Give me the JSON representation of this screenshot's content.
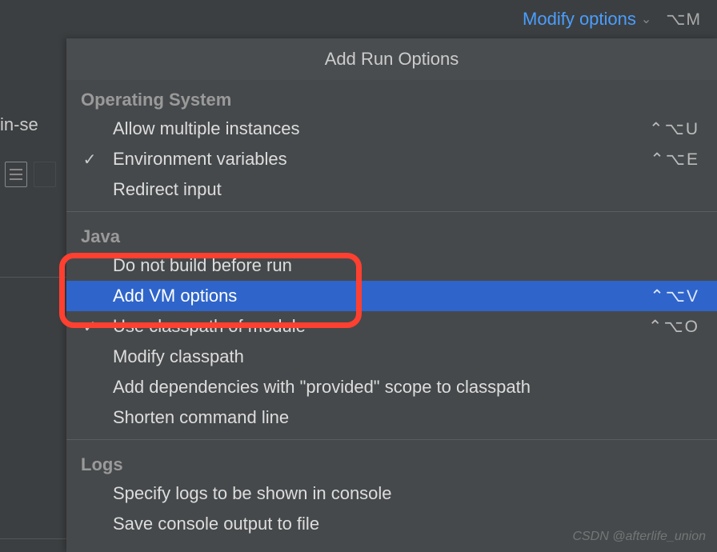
{
  "header": {
    "modify_label": "Modify options",
    "modify_shortcut": "⌥M"
  },
  "left": {
    "truncated_text": "in-se"
  },
  "panel": {
    "title": "Add Run Options",
    "sections": [
      {
        "header": "Operating System",
        "items": [
          {
            "label": "Allow multiple instances",
            "shortcut": "⌃⌥U",
            "checked": false
          },
          {
            "label": "Environment variables",
            "shortcut": "⌃⌥E",
            "checked": true
          },
          {
            "label": "Redirect input",
            "shortcut": "",
            "checked": false
          }
        ]
      },
      {
        "header": "Java",
        "items": [
          {
            "label": "Do not build before run",
            "shortcut": "",
            "checked": false
          },
          {
            "label": "Add VM options",
            "shortcut": "⌃⌥V",
            "checked": false,
            "selected": true
          },
          {
            "label": "Use classpath of module",
            "shortcut": "⌃⌥O",
            "checked": true
          },
          {
            "label": "Modify classpath",
            "shortcut": "",
            "checked": false
          },
          {
            "label": "Add dependencies with \"provided\" scope to classpath",
            "shortcut": "",
            "checked": false
          },
          {
            "label": "Shorten command line",
            "shortcut": "",
            "checked": false
          }
        ]
      },
      {
        "header": "Logs",
        "items": [
          {
            "label": "Specify logs to be shown in console",
            "shortcut": "",
            "checked": false
          },
          {
            "label": "Save console output to file",
            "shortcut": "",
            "checked": false
          }
        ]
      }
    ]
  },
  "watermark": "CSDN @afterlife_union"
}
